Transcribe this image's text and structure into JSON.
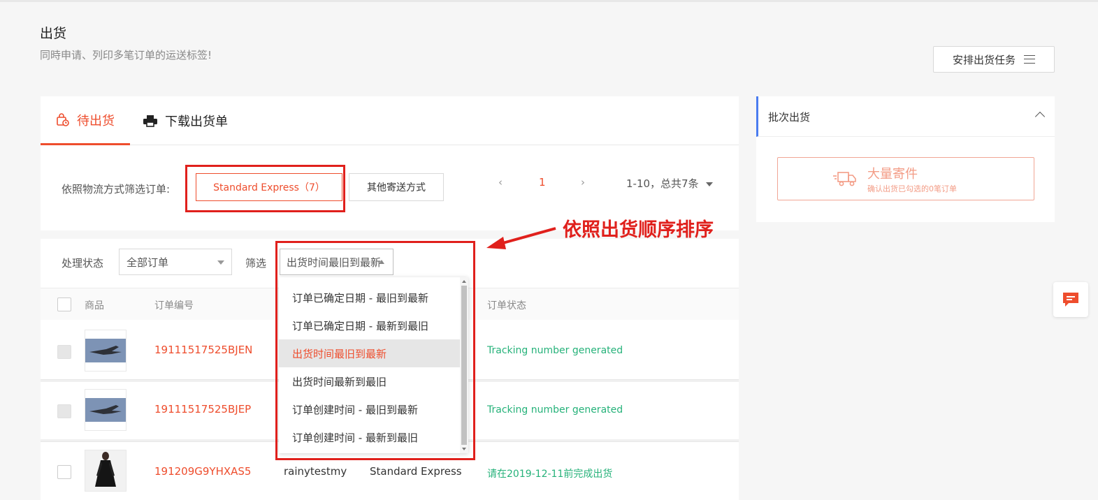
{
  "header": {
    "title": "出货",
    "subtitle": "同時申请、列印多笔订单的运送标签!",
    "arrange_button": "安排出货任务"
  },
  "tabs": [
    {
      "label": "待出货",
      "active": true
    },
    {
      "label": "下载出货单",
      "active": false
    }
  ],
  "carrier_filter": {
    "label": "依照物流方式筛选订单:",
    "options": [
      "Standard Express（7）",
      "其他寄送方式"
    ],
    "selected": "Standard Express（7）"
  },
  "pagination": {
    "prev": "‹",
    "current": "1",
    "next": "›",
    "range": "1-10，总共7条"
  },
  "status_filter": {
    "label": "处理状态",
    "value": "全部订单"
  },
  "sort_filter": {
    "label": "筛选",
    "value": "出货时间最旧到最新",
    "options": [
      "订单已确定日期 - 最旧到最新",
      "订单已确定日期 - 最新到最旧",
      "出货时间最旧到最新",
      "出货时间最新到最旧",
      "订单创建时间 - 最旧到最新",
      "订单创建时间 - 最新到最旧"
    ],
    "selected_index": 2
  },
  "table": {
    "columns": [
      "商品",
      "订单编号",
      "订单状态"
    ],
    "rows": [
      {
        "order_id": "19111517525BJEN",
        "buyer": "",
        "shipping": "",
        "status": "Tracking number generated",
        "thumb": "airplane"
      },
      {
        "order_id": "19111517525BJEP",
        "buyer": "",
        "shipping": "",
        "status": "Tracking number generated",
        "thumb": "airplane"
      },
      {
        "order_id": "191209G9YHXAS5",
        "buyer": "rainytestmy",
        "shipping": "Standard Express",
        "status": "请在2019-12-11前完成出货",
        "thumb": "dress"
      }
    ]
  },
  "annotation": "依照出货顺序排序",
  "side_panel": {
    "title": "批次出货",
    "bulk_button_title": "大量寄件",
    "bulk_button_sub": "确认出货已勾选的0笔订单"
  },
  "colors": {
    "accent": "#ee4d2d",
    "success": "#26b27a",
    "annotation": "#e0201c",
    "side_border": "#4a7cf0"
  }
}
